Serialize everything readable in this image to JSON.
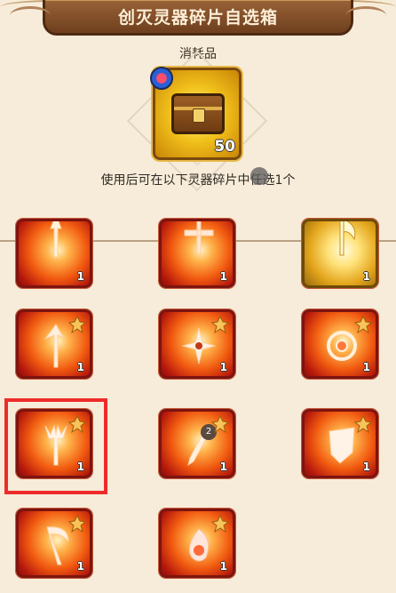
{
  "header": {
    "title": "创灭灵器碎片自选箱"
  },
  "item": {
    "kind": "消耗品",
    "count": "50",
    "description": "使用后可在以下灵器碎片中任选1个"
  },
  "colors": {
    "tile_red": "#b5180c",
    "tile_gold": "#e3a51c",
    "highlight": "#ee2b2b"
  },
  "options": [
    {
      "name": "spear-fragment",
      "count": "1"
    },
    {
      "name": "crossbow-fragment",
      "count": "1"
    },
    {
      "name": "golden-axe-fragment",
      "count": "1"
    },
    {
      "name": "halberd-fragment",
      "count": "1"
    },
    {
      "name": "shuriken-fragment",
      "count": "1"
    },
    {
      "name": "ring-blade-fragment",
      "count": "1"
    },
    {
      "name": "trident-fragment",
      "count": "1"
    },
    {
      "name": "lance-fragment",
      "count": "1",
      "badge": "2"
    },
    {
      "name": "shield-fragment",
      "count": "1"
    },
    {
      "name": "scythe-fragment",
      "count": "1"
    },
    {
      "name": "flame-orb-fragment",
      "count": "1"
    }
  ],
  "selected_index": 6
}
